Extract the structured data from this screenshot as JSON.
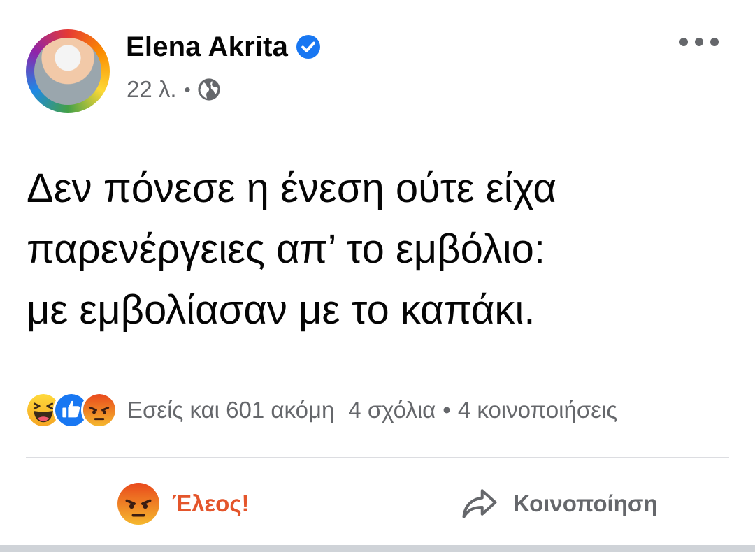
{
  "post": {
    "author": "Elena Akrita",
    "time": "22 λ.",
    "meta_separator": "•",
    "text_lines": [
      "Δεν πόνεσε η ένεση ούτε είχα",
      "παρενέργειες απ’ το εμβόλιο:",
      "με εμβολίασαν με το καπάκι."
    ]
  },
  "icons": {
    "verified": "verified-badge-icon",
    "audience": "globe-icon",
    "more": "more-options-icon",
    "reactions": [
      "haha-reaction-icon",
      "like-reaction-icon",
      "angry-reaction-icon"
    ],
    "share": "share-arrow-icon"
  },
  "stats": {
    "reactions_text": "Εσείς και 601 ακόμη",
    "comments": "4 σχόλια",
    "separator": "•",
    "shares": "4 κοινοποιήσεις"
  },
  "actions": {
    "react_label": "Έλεος!",
    "share_label": "Κοινοποίηση"
  },
  "colors": {
    "verified": "#1877f2",
    "angry_text": "#e4552b",
    "secondary_text": "#65676b",
    "divider": "#dcdde1"
  }
}
